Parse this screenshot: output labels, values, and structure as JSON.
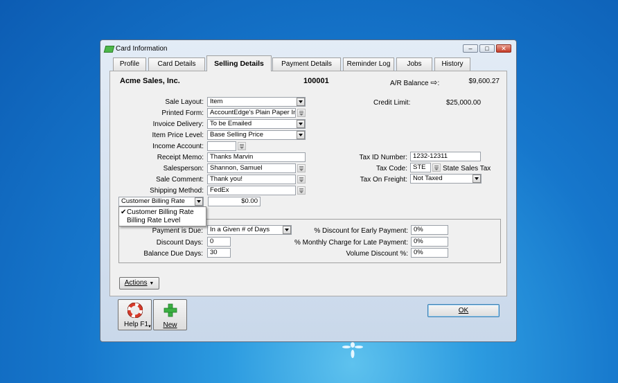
{
  "window": {
    "title": "Card Information"
  },
  "tabs": [
    {
      "label": "Profile"
    },
    {
      "label": "Card Details"
    },
    {
      "label": "Selling Details",
      "active": true
    },
    {
      "label": "Payment Details"
    },
    {
      "label": "Reminder Log"
    },
    {
      "label": "Jobs"
    },
    {
      "label": "History"
    }
  ],
  "header": {
    "card_name": "Acme Sales, Inc.",
    "card_id": "100001",
    "ar_balance_label": "A/R Balance",
    "ar_balance_arrow": "⇨",
    "ar_balance_colon": ":",
    "ar_balance_value": "$9,600.27",
    "credit_limit_label": "Credit Limit:",
    "credit_limit_value": "$25,000.00"
  },
  "left_fields": {
    "sale_layout": {
      "label": "Sale Layout:",
      "value": "Item"
    },
    "printed_form": {
      "label": "Printed Form:",
      "value": "AccountEdge's Plain Paper Inv"
    },
    "invoice_delivery": {
      "label": "Invoice Delivery:",
      "value": "To be Emailed"
    },
    "item_price_level": {
      "label": "Item Price Level:",
      "value": "Base Selling Price"
    },
    "income_account": {
      "label": "Income Account:",
      "value": ""
    },
    "receipt_memo": {
      "label": "Receipt Memo:",
      "value": "Thanks Marvin"
    },
    "salesperson": {
      "label": "Salesperson:",
      "value": "Shannon, Samuel"
    },
    "sale_comment": {
      "label": "Sale Comment:",
      "value": "Thank you!"
    },
    "shipping_method": {
      "label": "Shipping Method:",
      "value": "FedEx"
    }
  },
  "billing": {
    "select_value": "Customer Billing Rate",
    "amount": "$0.00",
    "options": [
      {
        "label": "Customer Billing Rate",
        "checked": "✔"
      },
      {
        "label": "Billing Rate Level",
        "checked": ""
      }
    ]
  },
  "right_fields": {
    "tax_id": {
      "label": "Tax ID Number:",
      "value": "1232-12311"
    },
    "tax_code": {
      "label": "Tax Code:",
      "value": "STE",
      "description": "State Sales Tax"
    },
    "tax_on_freight": {
      "label": "Tax On Freight:",
      "value": "Not Taxed"
    }
  },
  "terms": {
    "payment_is_due": {
      "label": "Payment is Due:",
      "value": "In a Given # of Days"
    },
    "discount_days": {
      "label": "Discount Days:",
      "value": "0"
    },
    "balance_due_days": {
      "label": "Balance Due Days:",
      "value": "30"
    },
    "discount_early": {
      "label": "% Discount for Early Payment:",
      "value": "0%"
    },
    "monthly_charge": {
      "label": "% Monthly Charge for Late Payment:",
      "value": "0%"
    },
    "volume_discount": {
      "label": "Volume Discount %:",
      "value": "0%"
    }
  },
  "buttons": {
    "actions": "Actions",
    "help": "Help F1",
    "new": "New",
    "ok": "OK"
  },
  "colors": {
    "desktop_accent": "#1677cc",
    "help_ring": "#d63a2a",
    "new_plus": "#3cb043"
  }
}
